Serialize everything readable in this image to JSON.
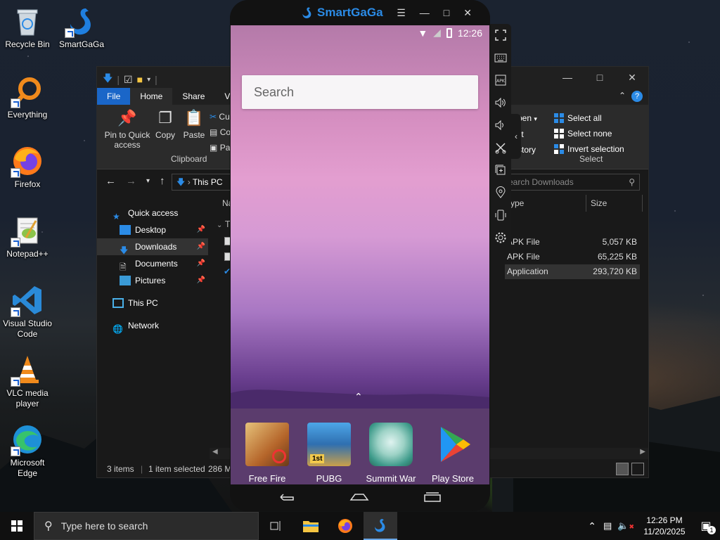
{
  "desktop": {
    "icons": [
      {
        "label": "Recycle Bin"
      },
      {
        "label": "SmartGaGa"
      },
      {
        "label": "Everything"
      },
      {
        "label": "Firefox"
      },
      {
        "label": "Notepad++"
      },
      {
        "label": "Visual Studio Code"
      },
      {
        "label": "VLC media player"
      },
      {
        "label": "Microsoft Edge"
      }
    ]
  },
  "explorer": {
    "tabs": {
      "file": "File",
      "home": "Home",
      "share": "Share",
      "view": "V"
    },
    "ribbon": {
      "pin_label": "Pin to Quick access",
      "copy_label": "Copy",
      "paste_label": "Paste",
      "cut_label": "Cu",
      "copy_path_label": "Co",
      "paste_shortcut_label": "Pa",
      "clipboard_group": "Clipboard",
      "open_label": "pen",
      "edit_label": "lit",
      "history_label": "story",
      "select_all": "Select all",
      "select_none": "Select none",
      "invert_selection": "Invert selection",
      "select_group": "Select"
    },
    "address": {
      "path_item": "This PC",
      "search_placeholder": "earch Downloads"
    },
    "nav": {
      "quick_access": "Quick access",
      "desktop": "Desktop",
      "downloads": "Downloads",
      "documents": "Documents",
      "pictures": "Pictures",
      "this_pc": "This PC",
      "network": "Network"
    },
    "columns": {
      "name": "Na",
      "type": "ype",
      "size": "Size"
    },
    "group_header": "T",
    "files": [
      {
        "type": "APK File",
        "size": "5,057 KB"
      },
      {
        "type": "APK File",
        "size": "65,225 KB"
      },
      {
        "type": "Application",
        "size": "293,720 KB"
      }
    ],
    "status": {
      "items": "3 items",
      "selected": "1 item selected",
      "size": "286 M"
    }
  },
  "emulator": {
    "title": "SmartGaGa",
    "time": "12:26",
    "search_placeholder": "Search",
    "apps": [
      {
        "label": "Free Fire"
      },
      {
        "label": "PUBG MOBI..."
      },
      {
        "label": "Summit War"
      },
      {
        "label": "Play Store"
      }
    ]
  },
  "taskbar": {
    "search_placeholder": "Type here to search",
    "time": "12:26 PM",
    "date": "11/20/2025",
    "notification_count": "1"
  },
  "colors": {
    "accent": "#1a66c8",
    "smartgaga_blue": "#2b8be6"
  }
}
